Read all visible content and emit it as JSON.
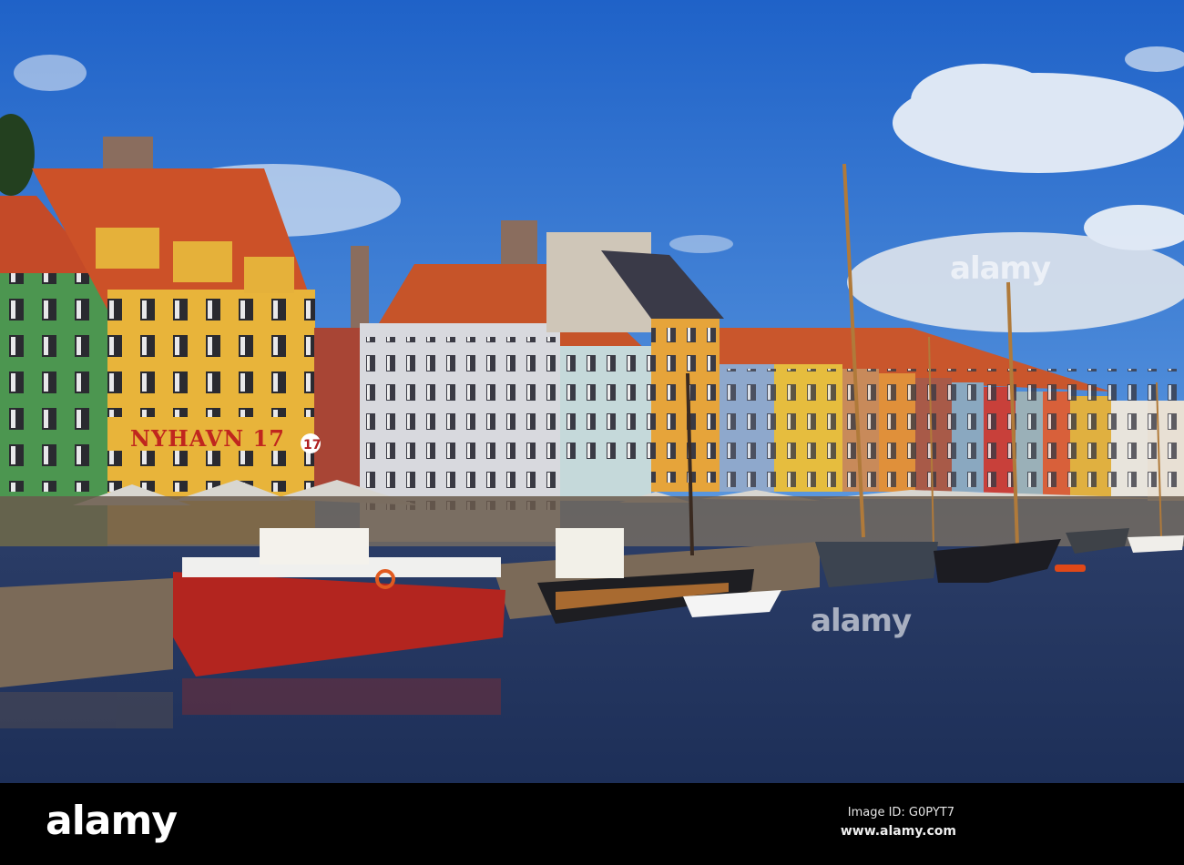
{
  "photo": {
    "subject": "Nyhavn harbour",
    "building_sign": "NYHAVN 17",
    "round_sign": "17"
  },
  "watermark": "alamy",
  "footer": {
    "logo": "alamy",
    "image_id": "Image ID: G0PYT7",
    "url": "www.alamy.com"
  }
}
